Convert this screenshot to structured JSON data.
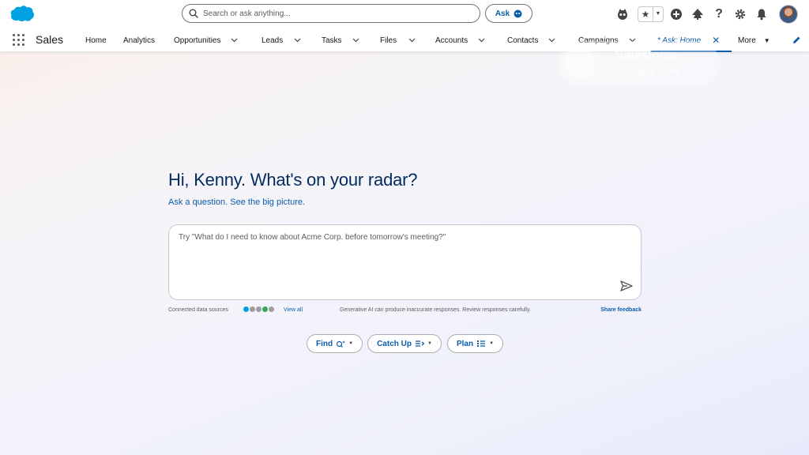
{
  "header": {
    "search": {
      "placeholder": "Search or ask anything..."
    },
    "ask_label": "Ask",
    "icons": [
      "agent-icon",
      "favorites-star-icon",
      "favorites-caret-icon",
      "global-actions-icon",
      "trailhead-icon",
      "help-icon",
      "setup-gear-icon",
      "notifications-bell-icon",
      "user-avatar"
    ]
  },
  "nav": {
    "app_name": "Sales",
    "items": [
      {
        "label": "Home",
        "has_menu": false
      },
      {
        "label": "Analytics",
        "has_menu": false
      },
      {
        "label": "Opportunities",
        "has_menu": true
      },
      {
        "label": "Leads",
        "has_menu": true
      },
      {
        "label": "Tasks",
        "has_menu": true
      },
      {
        "label": "Files",
        "has_menu": true
      },
      {
        "label": "Accounts",
        "has_menu": true
      },
      {
        "label": "Contacts",
        "has_menu": true
      },
      {
        "label": "Campaigns",
        "has_menu": true
      }
    ],
    "active_tab": {
      "label": "* Ask: Home"
    },
    "more_label": "More"
  },
  "watermark": {
    "line1": "Salesforce",
    "line2": "Available Now"
  },
  "main": {
    "greeting": "Hi, Kenny. What's on your radar?",
    "subgreeting": "Ask a question. See the big picture.",
    "prompt_placeholder": "Try \"What do I need to know about Acme Corp. before tomorrow's meeting?\"",
    "connected_sources_label": "Connected data sources",
    "view_all": "View all",
    "disclaimer": "Generative AI can produce inaccurate responses. Review responses carefully.",
    "share_feedback": "Share feedback",
    "actions": [
      {
        "label": "Find"
      },
      {
        "label": "Catch Up"
      },
      {
        "label": "Plan"
      }
    ]
  },
  "colors": {
    "brand_blue": "#0b5cab",
    "heading_navy": "#032d60",
    "salesforce_cloud": "#00a1e0"
  }
}
